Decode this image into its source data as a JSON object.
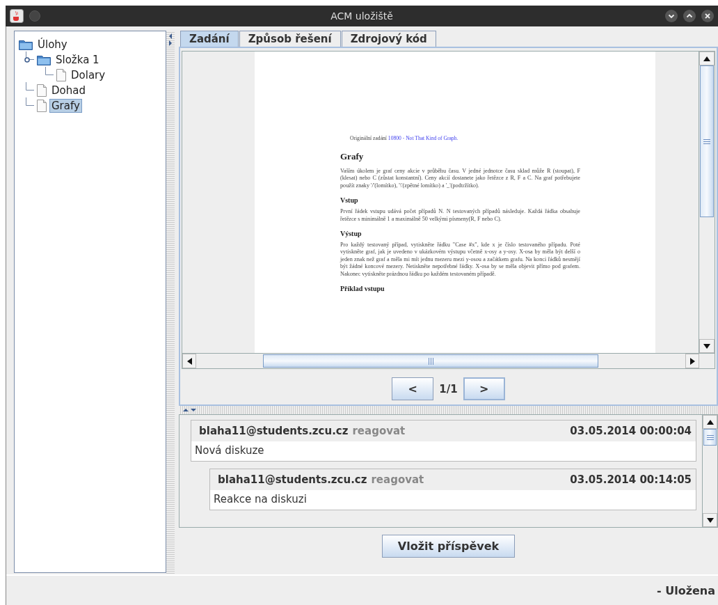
{
  "window": {
    "title": "ACM uložiště"
  },
  "tree": [
    {
      "label": "Úlohy",
      "kind": "folder",
      "selected": false,
      "children": [
        {
          "label": "Složka 1",
          "kind": "folder",
          "selected": false,
          "expanded": true,
          "children": [
            {
              "label": "Dolary",
              "kind": "file",
              "selected": false
            }
          ]
        },
        {
          "label": "Dohad",
          "kind": "file",
          "selected": false
        },
        {
          "label": "Grafy",
          "kind": "file",
          "selected": true
        }
      ]
    }
  ],
  "tabs": [
    {
      "label": "Zadání",
      "selected": true
    },
    {
      "label": "Způsob řešení",
      "selected": false
    },
    {
      "label": "Zdrojový kód",
      "selected": false
    }
  ],
  "document": {
    "source_note": {
      "text": "Originální zadání",
      "link": "10800 - Not That Kind of Graph."
    },
    "title": "Grafy",
    "intro": "Vaším úkolem je graf ceny akcie v průběhu času. V jedné jednotce času sklad může R (stoupat), F (klesat) nebo C (zůstat konstantní). Ceny akcií dostanete jako řetězce z R, F a C. Na graf potřebujete použít znaky '/'(lomítko), '\\'(zpětné lomítko) a '_'(podtržítko).",
    "sections": [
      {
        "heading": "Vstup",
        "text": "První řádek vstupu udává počet případů N. N testovaných případů následuje. Každá řádka obsahuje řetězce s minimálně 1 a maximálně 50 velkými písmeny(R, F nebo C)."
      },
      {
        "heading": "Výstup",
        "text": "Pro každý testovaný případ, vytiskněte řádku \"Case #x\", kde x je číslo testovaného případu. Poté vytiskněte graf, jak je uvedeno v ukázkovém výstupu včetně x-osy a y-osy. X-osa by měla být delší o jeden znak než graf a měla mi mít jednu mezeru mezi y-osou a začátkem grafu. Na konci řádků nesmějí být žádné koncové mezery. Netiskněte nepotřebné řádky. X-osa by se měla objevit přímo pod grafem. Nakonec vytiskněte prázdnou řádku po každém testovaném případě."
      },
      {
        "heading": "Příklad vstupu"
      }
    ]
  },
  "pager": {
    "prev": "<",
    "page": "1/1",
    "next": ">"
  },
  "comments": [
    {
      "author": "blaha11@students.zcu.cz",
      "reply": "reagovat",
      "time": "03.05.2014 00:00:04",
      "text": "Nová diskuze",
      "children": [
        {
          "author": "blaha11@students.zcu.cz",
          "reply": "reagovat",
          "time": "03.05.2014 00:14:05",
          "text": "Reakce na diskuzi"
        }
      ]
    }
  ],
  "post_button": "Vložit příspěvek",
  "status": "- Uložena"
}
